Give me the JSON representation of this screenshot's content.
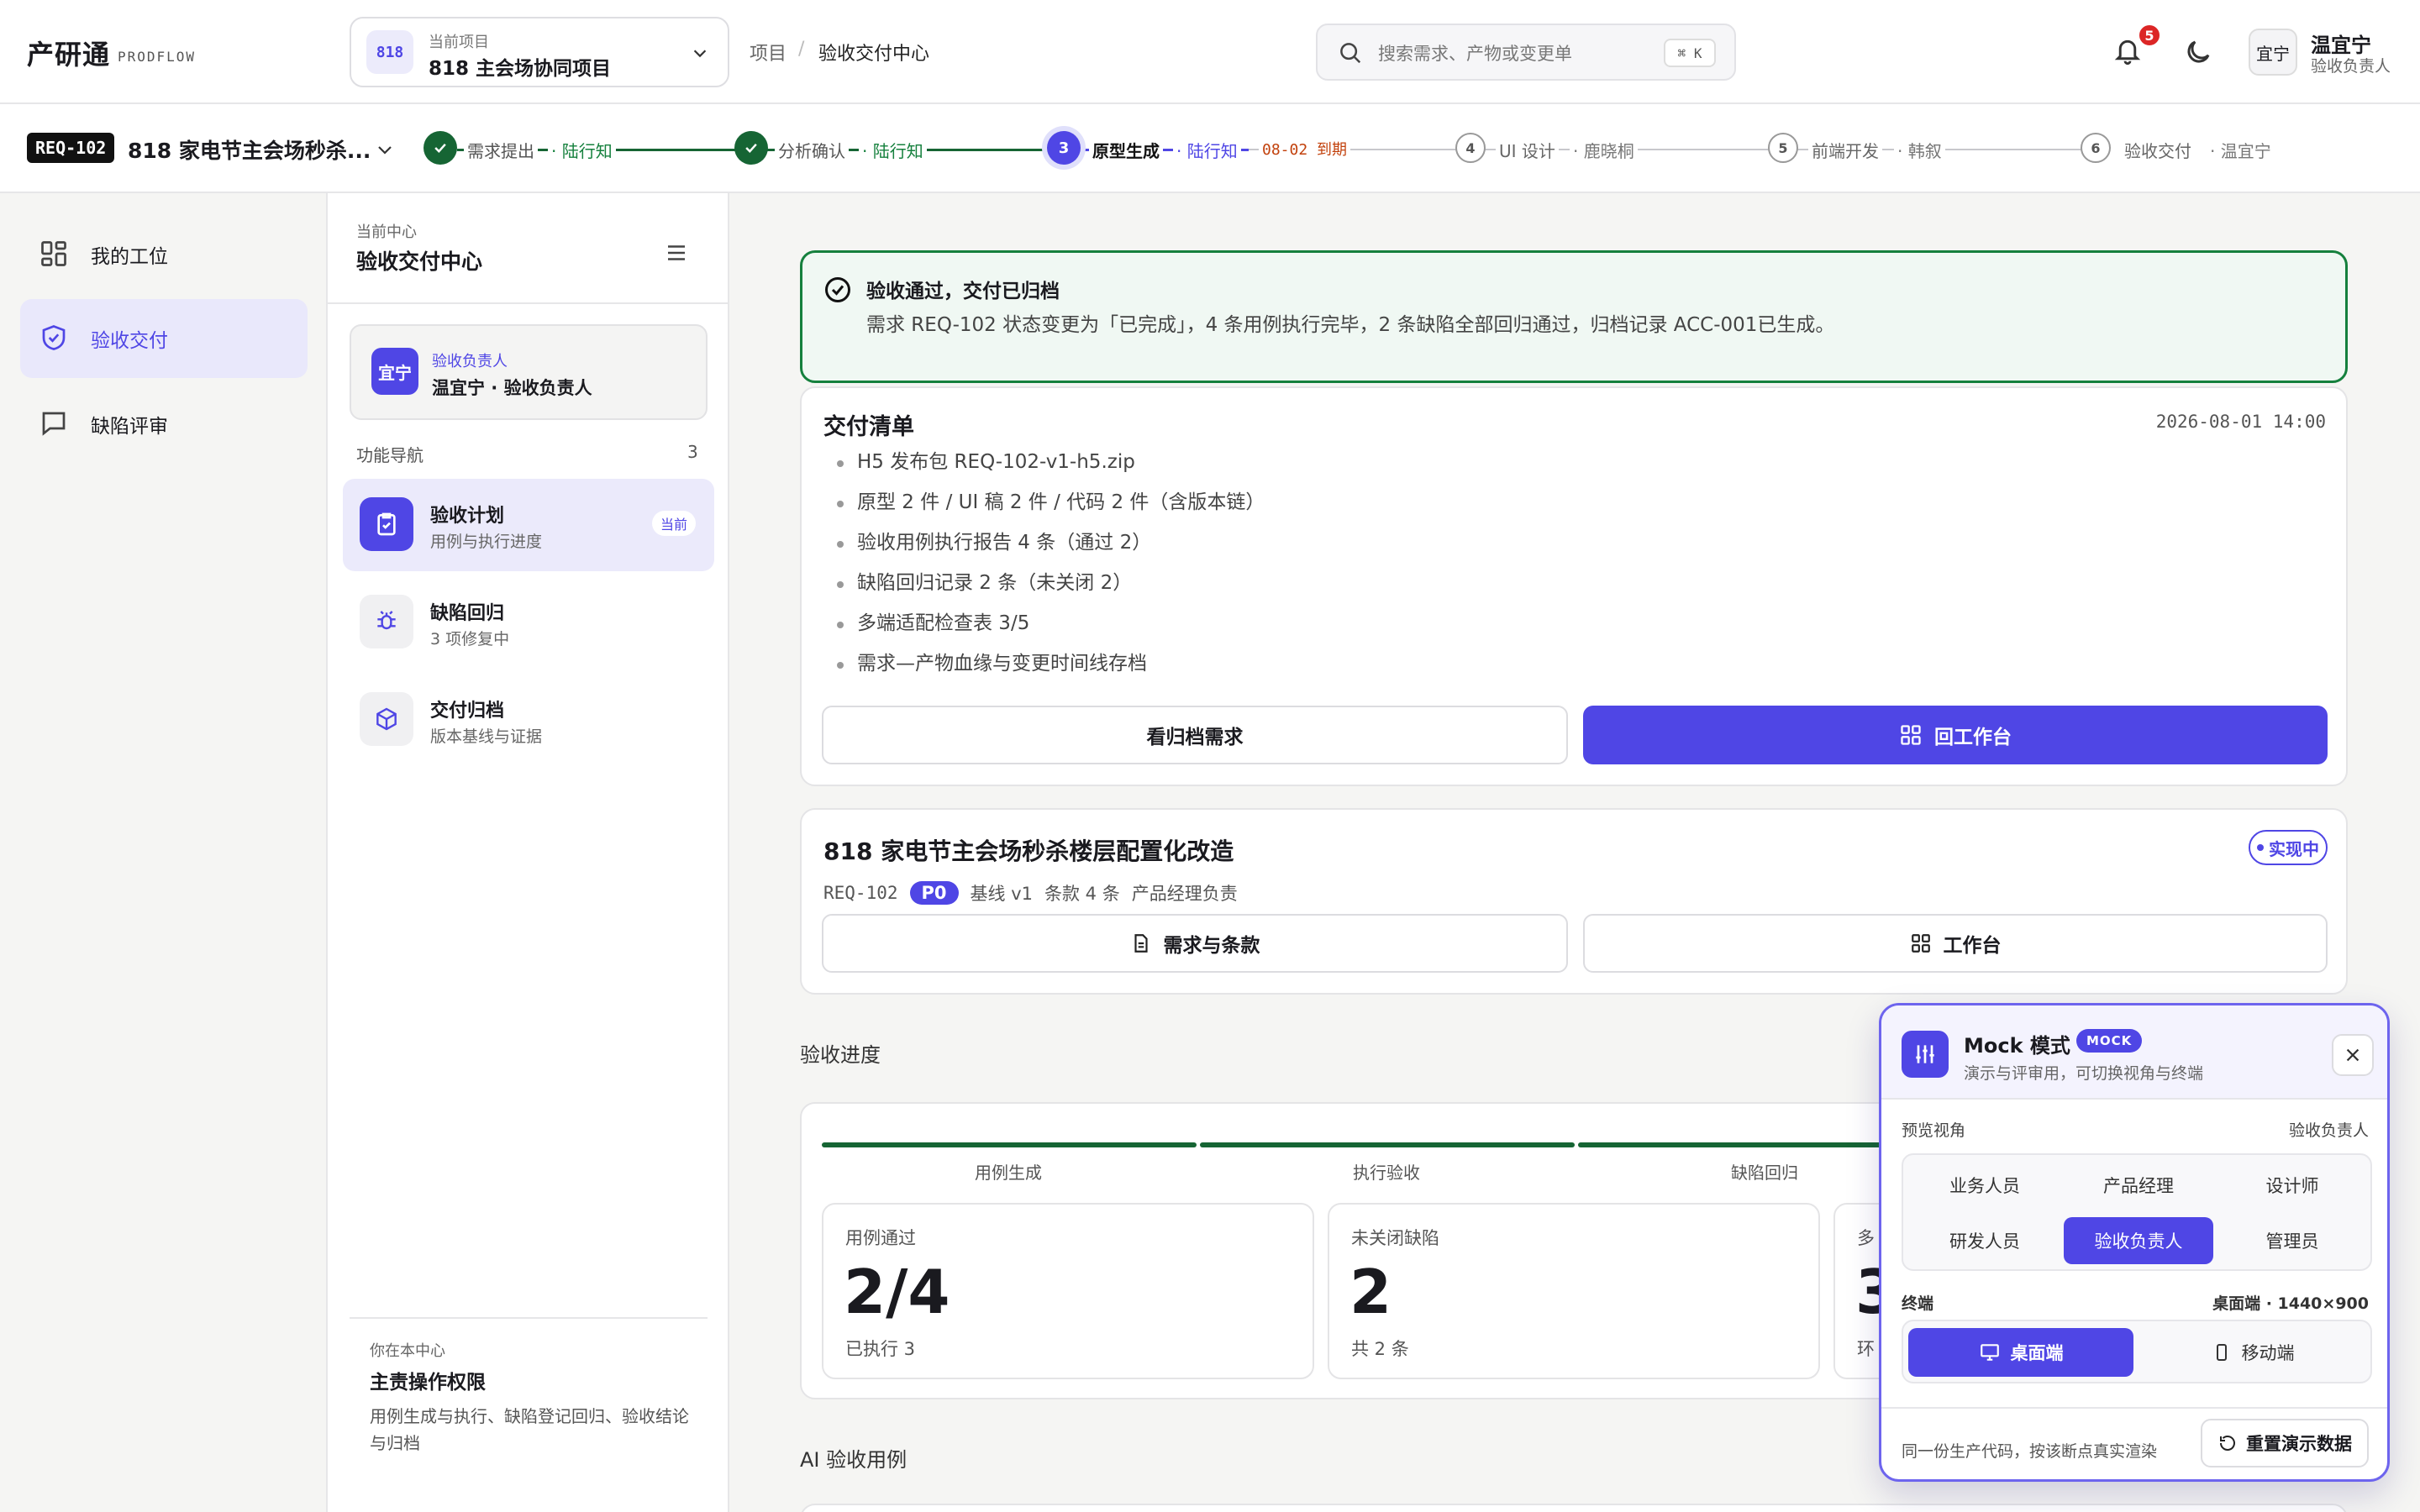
{
  "brand": {
    "name": "产研通",
    "sub": "PRODFLOW"
  },
  "project": {
    "badge": "818",
    "caption": "当前项目",
    "name": "818 主会场协同项目"
  },
  "breadcrumb": {
    "root": "项目",
    "sep": "/",
    "current": "验收交付中心"
  },
  "search": {
    "placeholder": "搜索需求、产物或变更单",
    "shortcut": "⌘ K"
  },
  "notifications": {
    "count": "5"
  },
  "user": {
    "avatar": "宜宁",
    "name": "温宜宁",
    "role": "验收负责人"
  },
  "requirement": {
    "id": "REQ-102",
    "title": "818 家电节主会场秒杀..."
  },
  "steps": [
    {
      "num": "1",
      "label": "需求提出",
      "owner": "· 陆行知",
      "state": "done"
    },
    {
      "num": "2",
      "label": "分析确认",
      "owner": "· 陆行知",
      "state": "done"
    },
    {
      "num": "3",
      "label": "原型生成",
      "owner": "· 陆行知",
      "due": "08-02 到期",
      "state": "current"
    },
    {
      "num": "4",
      "label": "UI 设计",
      "owner": "· 鹿晓桐",
      "state": "todo"
    },
    {
      "num": "5",
      "label": "前端开发",
      "owner": "· 韩叙",
      "state": "todo"
    },
    {
      "num": "6",
      "label": "验收交付",
      "owner": "· 温宜宁",
      "state": "todo"
    }
  ],
  "leftnav": {
    "items": [
      {
        "label": "我的工位",
        "icon": "grid-icon"
      },
      {
        "label": "验收交付",
        "icon": "shield-icon",
        "active": true
      },
      {
        "label": "缺陷评审",
        "icon": "chat-icon"
      }
    ]
  },
  "center": {
    "caption": "当前中心",
    "title": "验收交付中心",
    "owner": {
      "avatar": "宜宁",
      "role": "验收负责人",
      "name": "温宜宁 · 验收负责人"
    },
    "fn_head": "功能导航",
    "fn_count": "3",
    "items": [
      {
        "title": "验收计划",
        "sub": "用例与执行进度",
        "tag": "当前"
      },
      {
        "title": "缺陷回归",
        "sub": "3 项修复中"
      },
      {
        "title": "交付归档",
        "sub": "版本基线与证据"
      }
    ],
    "perm": {
      "caption": "你在本中心",
      "title": "主责操作权限",
      "desc": "用例生成与执行、缺陷登记回归、验收结论与归档"
    }
  },
  "success": {
    "title": "验收通过，交付已归档",
    "desc": "需求 REQ-102 状态变更为「已完成」，4 条用例执行完毕，2 条缺陷全部回归通过，归档记录 ACC-001已生成。"
  },
  "delivery": {
    "title": "交付清单",
    "time": "2026-08-01 14:00",
    "items": [
      "H5 发布包 REQ-102-v1-h5.zip",
      "原型 2 件 / UI 稿 2 件 / 代码 2 件（含版本链）",
      "验收用例执行报告 4 条（通过 2）",
      "缺陷回归记录 2 条（未关闭 2）",
      "多端适配检查表 3/5",
      "需求—产物血缘与变更时间线存档"
    ],
    "btn_archive": "看归档需求",
    "btn_workbench": "回工作台"
  },
  "req_card": {
    "name": "818 家电节主会场秒杀楼层配置化改造",
    "status": "实现中",
    "id": "REQ-102",
    "priority": "P0",
    "baseline": "基线 v1",
    "clauses": "条款 4 条",
    "owner": "产品经理负责",
    "btn_spec": "需求与条款",
    "btn_workbench": "工作台"
  },
  "progress": {
    "section": "验收进度",
    "phases": [
      "用例生成",
      "执行验收",
      "缺陷回归"
    ],
    "stats": [
      {
        "caption": "用例通过",
        "value": "2/4",
        "sub": "已执行 3"
      },
      {
        "caption": "未关闭缺陷",
        "value": "2",
        "sub": "共 2 条"
      },
      {
        "caption": "多",
        "value": "3",
        "sub": "环"
      }
    ]
  },
  "ai_section": "AI 验收用例",
  "mock": {
    "title": "Mock 模式",
    "badge": "MOCK",
    "sub": "演示与评审用，可切换视角与终端",
    "view_label": "预览视角",
    "view_value": "验收负责人",
    "roles": [
      "业务人员",
      "产品经理",
      "设计师",
      "研发人员",
      "验收负责人",
      "管理员"
    ],
    "selected_role": "验收负责人",
    "term_label": "终端",
    "term_value": "桌面端 · 1440×900",
    "terminals": [
      "桌面端",
      "移动端"
    ],
    "note": "同一份生产代码，按该断点真实渲染",
    "reset": "重置演示数据"
  },
  "colors": {
    "accent": "#4f46e5",
    "success": "#166534",
    "due": "#c2410c"
  }
}
